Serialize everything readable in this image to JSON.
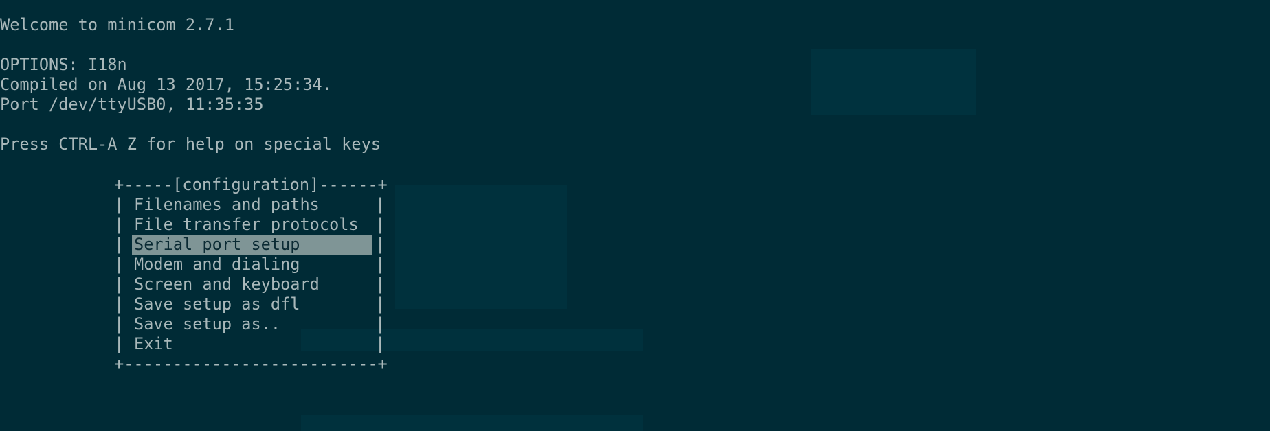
{
  "terminal": {
    "welcome": "Welcome to minicom 2.7.1",
    "options": "OPTIONS: I18n",
    "compiled": "Compiled on Aug 13 2017, 15:25:34.",
    "port": "Port /dev/ttyUSB0, 11:35:35",
    "help": "Press CTRL-A Z for help on special keys"
  },
  "menu": {
    "top_border": "+-----[configuration]------+",
    "bottom_border": "+--------------------------+",
    "items": [
      {
        "label": "Filenames and paths"
      },
      {
        "label": "File transfer protocols"
      },
      {
        "label": "Serial port setup",
        "selected": true
      },
      {
        "label": "Modem and dialing"
      },
      {
        "label": "Screen and keyboard"
      },
      {
        "label": "Save setup as dfl"
      },
      {
        "label": "Save setup as.."
      },
      {
        "label": "Exit"
      }
    ]
  },
  "colors": {
    "background": "#002b36",
    "text": "#a9b8ba",
    "highlight": "#7f9596"
  }
}
